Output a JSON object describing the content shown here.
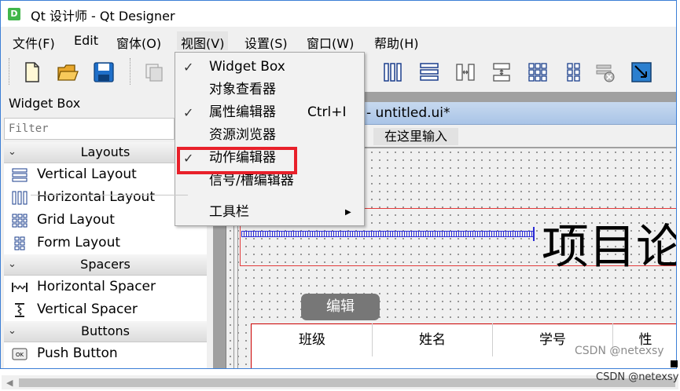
{
  "window": {
    "title": "Qt 设计师 - Qt Designer",
    "app_icon_letter": "D"
  },
  "menubar": {
    "items": [
      "文件(F)",
      "Edit",
      "窗体(O)",
      "视图(V)",
      "设置(S)",
      "窗口(W)",
      "帮助(H)"
    ],
    "open_menu": "视图(V)"
  },
  "toolbar": {
    "icons": [
      "new-file-icon",
      "open-folder-icon",
      "save-icon",
      "copy-icon",
      "horizontal-layout-icon",
      "vertical-layout-icon",
      "horizontal-splitter-icon",
      "vertical-splitter-icon",
      "grid-layout-icon",
      "form-layout-icon",
      "break-layout-icon",
      "adjust-size-icon"
    ]
  },
  "view_menu": {
    "items": [
      {
        "label": "Widget Box",
        "checked": true,
        "shortcut": ""
      },
      {
        "label": "对象查看器",
        "checked": false,
        "shortcut": ""
      },
      {
        "label": "属性编辑器",
        "checked": true,
        "shortcut": "Ctrl+I"
      },
      {
        "label": "资源浏览器",
        "checked": false,
        "shortcut": ""
      },
      {
        "label": "动作编辑器",
        "checked": true,
        "shortcut": ""
      },
      {
        "label": "信号/槽编辑器",
        "checked": false,
        "shortcut": ""
      },
      {
        "label": "工具栏",
        "checked": false,
        "shortcut": "",
        "submenu": true
      }
    ],
    "check_glyph": "✓",
    "submenu_glyph": "▶",
    "highlighted_item": "动作编辑器",
    "highlight_color": "#e8202a"
  },
  "widget_box": {
    "title": "Widget Box",
    "filter_placeholder": "Filter",
    "categories": [
      {
        "name": "Layouts",
        "items": [
          "Vertical Layout",
          "Horizontal Layout",
          "Grid Layout",
          "Form Layout"
        ]
      },
      {
        "name": "Spacers",
        "items": [
          "Horizontal Spacer",
          "Vertical Spacer"
        ]
      },
      {
        "name": "Buttons",
        "items": [
          "Push Button"
        ]
      }
    ],
    "chevron_glyph": "⌄"
  },
  "designer": {
    "subwindow_title": "- untitled.ui*",
    "type_here": "在这里输入",
    "heading_text": "项目论",
    "edit_button": "编辑",
    "table_headers": [
      "班级",
      "姓名",
      "学号",
      "性"
    ]
  },
  "watermarks": {
    "inner": "CSDN @netexsy",
    "outer": "CSDN @netexsy"
  },
  "colors": {
    "accent_blue": "#3c7fd6",
    "spacer_blue": "#2a2ad6",
    "layout_red": "#e33c3c"
  }
}
